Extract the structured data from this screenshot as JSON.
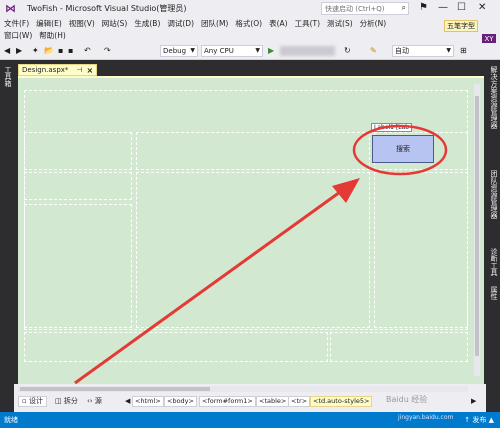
{
  "window": {
    "title": "TwoFish - Microsoft Visual Studio(管理员)",
    "quick_launch_placeholder": "快速启动 (Ctrl+Q)",
    "sign_in": "五笔字型",
    "user_initials": "XY"
  },
  "menus": {
    "row1": [
      "文件(F)",
      "编辑(E)",
      "视图(V)",
      "网站(S)",
      "生成(B)",
      "调试(D)",
      "团队(M)",
      "格式(O)",
      "表(A)",
      "工具(T)",
      "测试(S)",
      "分析(N)"
    ],
    "row2": [
      "窗口(W)",
      "帮助(H)"
    ]
  },
  "toolbar": {
    "config": "Debug",
    "platform": "Any CPU",
    "layout": "自动"
  },
  "side_panels": {
    "left": "工具箱",
    "right": [
      "解决方案资源管理器",
      "团队资源管理器",
      "诊断工具",
      "属性"
    ]
  },
  "document": {
    "tab_label": "Design.aspx*",
    "label_control": "Label1 [Lab",
    "search_button": "搜索"
  },
  "bottom": {
    "view_tabs": [
      "设计",
      "拆分",
      "源"
    ],
    "breadcrumbs": [
      "<html>",
      "<body>",
      "<form#form1>",
      "<table>",
      "<tr>",
      "<td.auto-style5>"
    ]
  },
  "status": {
    "left": "就绪",
    "right": "↑ 发布 ▲"
  },
  "watermark": {
    "line1": "Baidu 经验",
    "line2": "jingyan.baidu.com"
  },
  "colors": {
    "design_background": "#d3e8d1",
    "accent_purple": "#68217a",
    "status_blue": "#007acc",
    "annotation_red": "#e53935"
  }
}
